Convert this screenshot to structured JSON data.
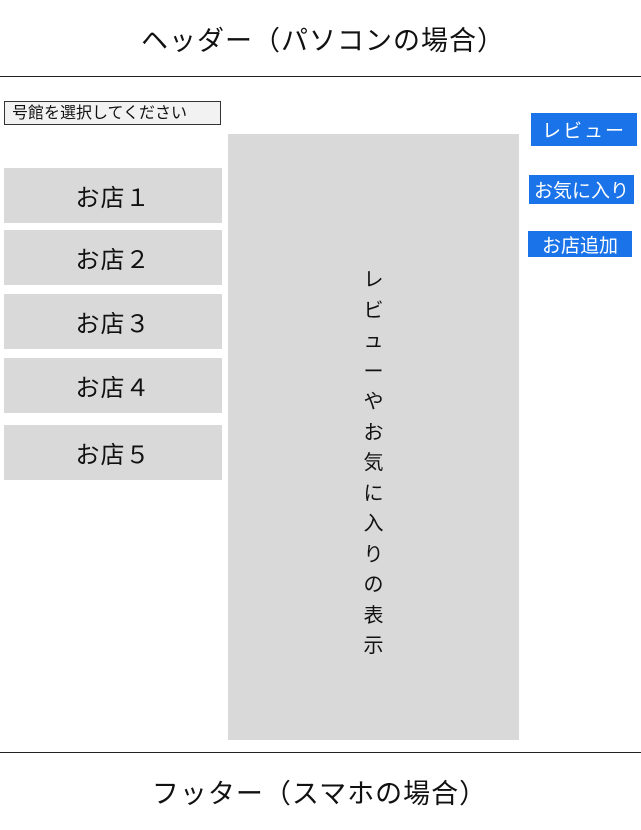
{
  "header": {
    "title": "ヘッダー（パソコンの場合）"
  },
  "sidebar": {
    "building_select_label": "号館を選択してください",
    "shops": [
      {
        "label": "お店１"
      },
      {
        "label": "お店２"
      },
      {
        "label": "お店３"
      },
      {
        "label": "お店４"
      },
      {
        "label": "お店５"
      }
    ]
  },
  "main": {
    "display_text": "レビューやお気に入りの表示",
    "display_chars": [
      "レ",
      "ビ",
      "ュ",
      "ー",
      "や",
      "お",
      "気",
      "に",
      "入",
      "り",
      "の",
      "表",
      "示"
    ]
  },
  "actions": {
    "review_label": "レビュー",
    "favorite_label": "お気に入り",
    "add_shop_label": "お店追加",
    "button_color": "#1a73e8"
  },
  "footer": {
    "title": "フッター（スマホの場合）"
  }
}
